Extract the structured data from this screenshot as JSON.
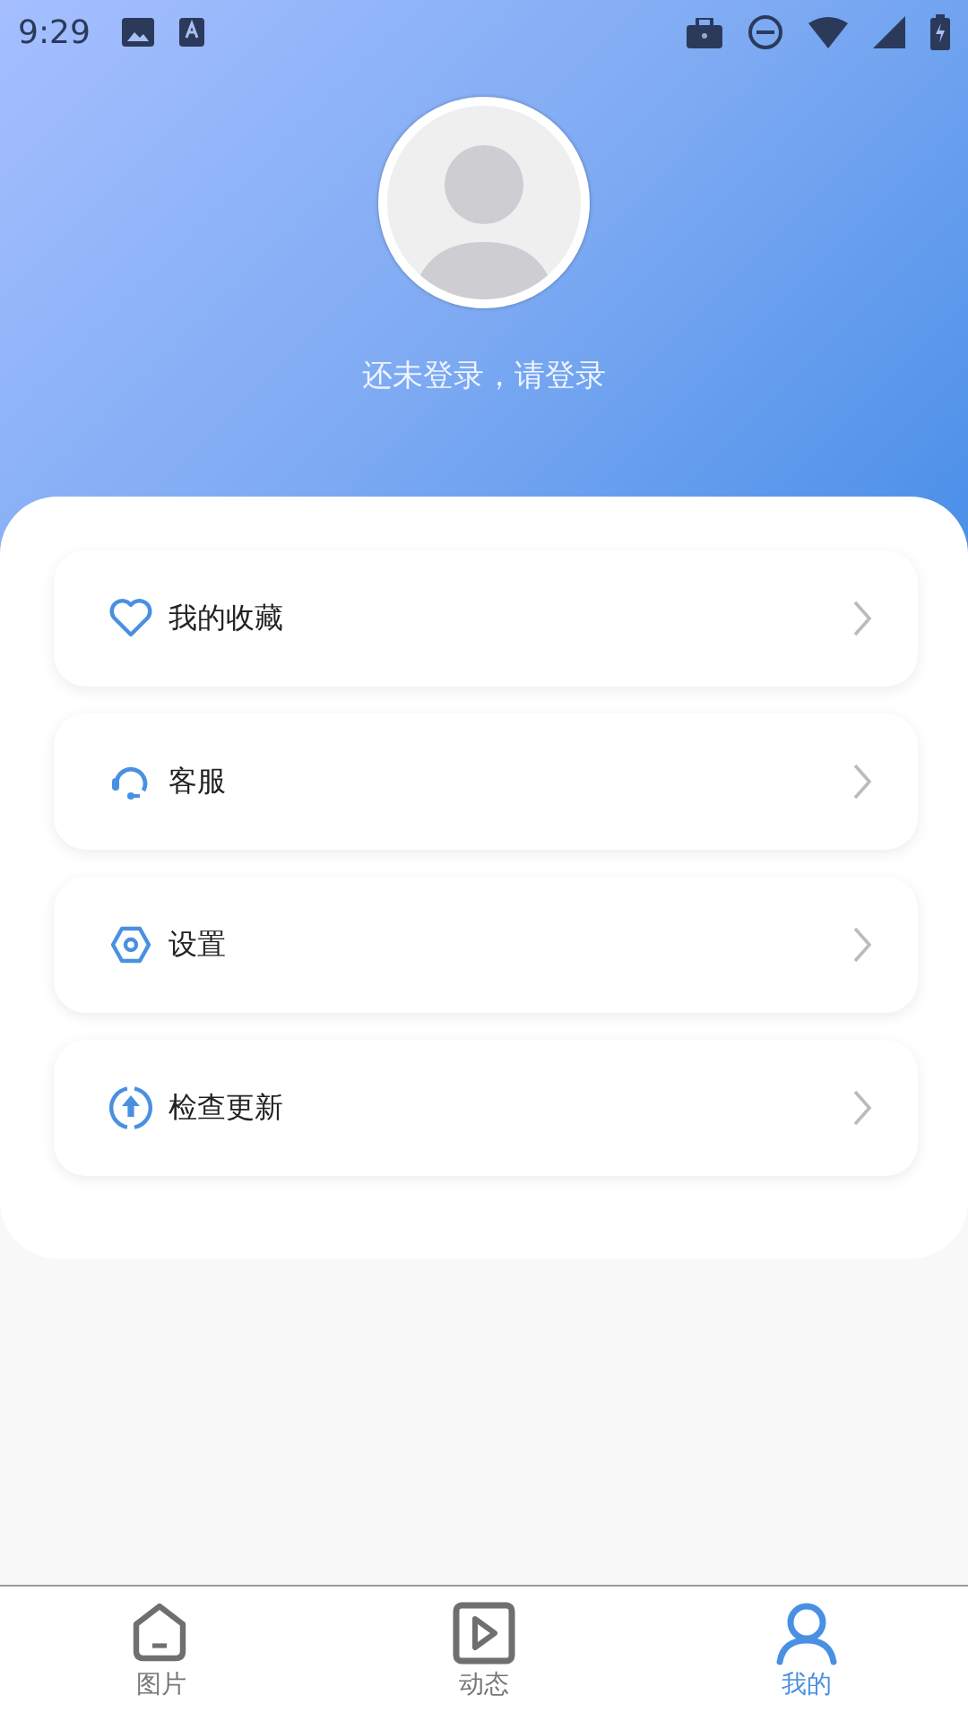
{
  "status_bar": {
    "time": "9:29"
  },
  "profile": {
    "login_prompt": "还未登录，请登录"
  },
  "menu": [
    {
      "kind": "favorite",
      "label": "我的收藏"
    },
    {
      "kind": "support",
      "label": "客服"
    },
    {
      "kind": "settings",
      "label": "设置"
    },
    {
      "kind": "update",
      "label": "检查更新"
    }
  ],
  "tabs": [
    {
      "kind": "pictures",
      "label": "图片",
      "selected": false
    },
    {
      "kind": "moments",
      "label": "动态",
      "selected": false
    },
    {
      "kind": "mine",
      "label": "我的",
      "selected": true
    }
  ]
}
